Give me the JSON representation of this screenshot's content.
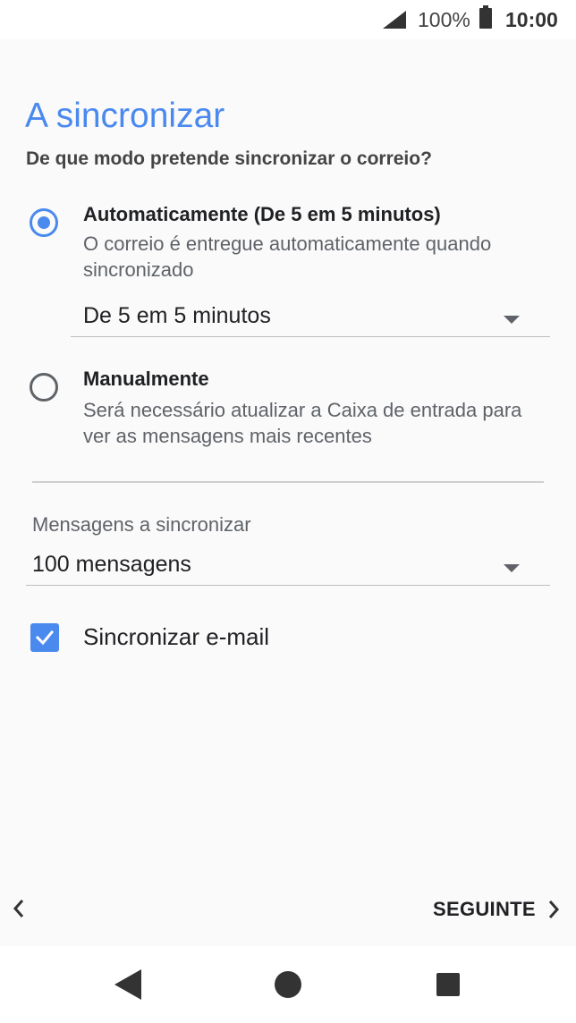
{
  "status_bar": {
    "battery_percent": "100%",
    "time": "10:00",
    "signal_icon": "signal-icon",
    "battery_icon": "battery-icon"
  },
  "page": {
    "title": "A sincronizar",
    "subtitle": "De que modo pretende sincronizar o correio?"
  },
  "sync_options": [
    {
      "title": "Automaticamente (De 5 em 5 minutos)",
      "description": "O correio é entregue automaticamente quando sincronizado",
      "selected": true
    },
    {
      "title": "Manualmente",
      "description": "Será necessário atualizar a Caixa de entrada para ver as mensagens mais recentes",
      "selected": false
    }
  ],
  "interval_dropdown": {
    "value": "De 5 em 5 minutos"
  },
  "messages_field": {
    "label": "Mensagens a sincronizar",
    "value": "100 mensagens"
  },
  "sync_email_checkbox": {
    "label": "Sincronizar e-mail",
    "checked": true
  },
  "footer": {
    "next_label": "SEGUINTE"
  },
  "colors": {
    "accent": "#4a89ee",
    "background": "#fafafa"
  }
}
